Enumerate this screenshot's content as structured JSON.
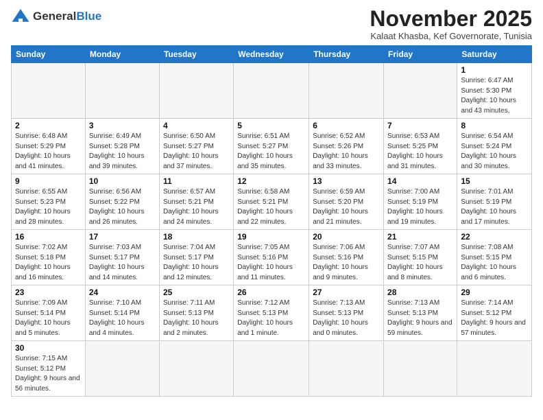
{
  "header": {
    "logo_line1": "General",
    "logo_line2": "Blue",
    "month": "November 2025",
    "location": "Kalaat Khasba, Kef Governorate, Tunisia"
  },
  "days_of_week": [
    "Sunday",
    "Monday",
    "Tuesday",
    "Wednesday",
    "Thursday",
    "Friday",
    "Saturday"
  ],
  "weeks": [
    [
      {
        "day": "",
        "info": ""
      },
      {
        "day": "",
        "info": ""
      },
      {
        "day": "",
        "info": ""
      },
      {
        "day": "",
        "info": ""
      },
      {
        "day": "",
        "info": ""
      },
      {
        "day": "",
        "info": ""
      },
      {
        "day": "1",
        "info": "Sunrise: 6:47 AM\nSunset: 5:30 PM\nDaylight: 10 hours and 43 minutes."
      }
    ],
    [
      {
        "day": "2",
        "info": "Sunrise: 6:48 AM\nSunset: 5:29 PM\nDaylight: 10 hours and 41 minutes."
      },
      {
        "day": "3",
        "info": "Sunrise: 6:49 AM\nSunset: 5:28 PM\nDaylight: 10 hours and 39 minutes."
      },
      {
        "day": "4",
        "info": "Sunrise: 6:50 AM\nSunset: 5:27 PM\nDaylight: 10 hours and 37 minutes."
      },
      {
        "day": "5",
        "info": "Sunrise: 6:51 AM\nSunset: 5:27 PM\nDaylight: 10 hours and 35 minutes."
      },
      {
        "day": "6",
        "info": "Sunrise: 6:52 AM\nSunset: 5:26 PM\nDaylight: 10 hours and 33 minutes."
      },
      {
        "day": "7",
        "info": "Sunrise: 6:53 AM\nSunset: 5:25 PM\nDaylight: 10 hours and 31 minutes."
      },
      {
        "day": "8",
        "info": "Sunrise: 6:54 AM\nSunset: 5:24 PM\nDaylight: 10 hours and 30 minutes."
      }
    ],
    [
      {
        "day": "9",
        "info": "Sunrise: 6:55 AM\nSunset: 5:23 PM\nDaylight: 10 hours and 28 minutes."
      },
      {
        "day": "10",
        "info": "Sunrise: 6:56 AM\nSunset: 5:22 PM\nDaylight: 10 hours and 26 minutes."
      },
      {
        "day": "11",
        "info": "Sunrise: 6:57 AM\nSunset: 5:21 PM\nDaylight: 10 hours and 24 minutes."
      },
      {
        "day": "12",
        "info": "Sunrise: 6:58 AM\nSunset: 5:21 PM\nDaylight: 10 hours and 22 minutes."
      },
      {
        "day": "13",
        "info": "Sunrise: 6:59 AM\nSunset: 5:20 PM\nDaylight: 10 hours and 21 minutes."
      },
      {
        "day": "14",
        "info": "Sunrise: 7:00 AM\nSunset: 5:19 PM\nDaylight: 10 hours and 19 minutes."
      },
      {
        "day": "15",
        "info": "Sunrise: 7:01 AM\nSunset: 5:19 PM\nDaylight: 10 hours and 17 minutes."
      }
    ],
    [
      {
        "day": "16",
        "info": "Sunrise: 7:02 AM\nSunset: 5:18 PM\nDaylight: 10 hours and 16 minutes."
      },
      {
        "day": "17",
        "info": "Sunrise: 7:03 AM\nSunset: 5:17 PM\nDaylight: 10 hours and 14 minutes."
      },
      {
        "day": "18",
        "info": "Sunrise: 7:04 AM\nSunset: 5:17 PM\nDaylight: 10 hours and 12 minutes."
      },
      {
        "day": "19",
        "info": "Sunrise: 7:05 AM\nSunset: 5:16 PM\nDaylight: 10 hours and 11 minutes."
      },
      {
        "day": "20",
        "info": "Sunrise: 7:06 AM\nSunset: 5:16 PM\nDaylight: 10 hours and 9 minutes."
      },
      {
        "day": "21",
        "info": "Sunrise: 7:07 AM\nSunset: 5:15 PM\nDaylight: 10 hours and 8 minutes."
      },
      {
        "day": "22",
        "info": "Sunrise: 7:08 AM\nSunset: 5:15 PM\nDaylight: 10 hours and 6 minutes."
      }
    ],
    [
      {
        "day": "23",
        "info": "Sunrise: 7:09 AM\nSunset: 5:14 PM\nDaylight: 10 hours and 5 minutes."
      },
      {
        "day": "24",
        "info": "Sunrise: 7:10 AM\nSunset: 5:14 PM\nDaylight: 10 hours and 4 minutes."
      },
      {
        "day": "25",
        "info": "Sunrise: 7:11 AM\nSunset: 5:13 PM\nDaylight: 10 hours and 2 minutes."
      },
      {
        "day": "26",
        "info": "Sunrise: 7:12 AM\nSunset: 5:13 PM\nDaylight: 10 hours and 1 minute."
      },
      {
        "day": "27",
        "info": "Sunrise: 7:13 AM\nSunset: 5:13 PM\nDaylight: 10 hours and 0 minutes."
      },
      {
        "day": "28",
        "info": "Sunrise: 7:13 AM\nSunset: 5:13 PM\nDaylight: 9 hours and 59 minutes."
      },
      {
        "day": "29",
        "info": "Sunrise: 7:14 AM\nSunset: 5:12 PM\nDaylight: 9 hours and 57 minutes."
      }
    ],
    [
      {
        "day": "30",
        "info": "Sunrise: 7:15 AM\nSunset: 5:12 PM\nDaylight: 9 hours and 56 minutes."
      },
      {
        "day": "",
        "info": ""
      },
      {
        "day": "",
        "info": ""
      },
      {
        "day": "",
        "info": ""
      },
      {
        "day": "",
        "info": ""
      },
      {
        "day": "",
        "info": ""
      },
      {
        "day": "",
        "info": ""
      }
    ]
  ]
}
